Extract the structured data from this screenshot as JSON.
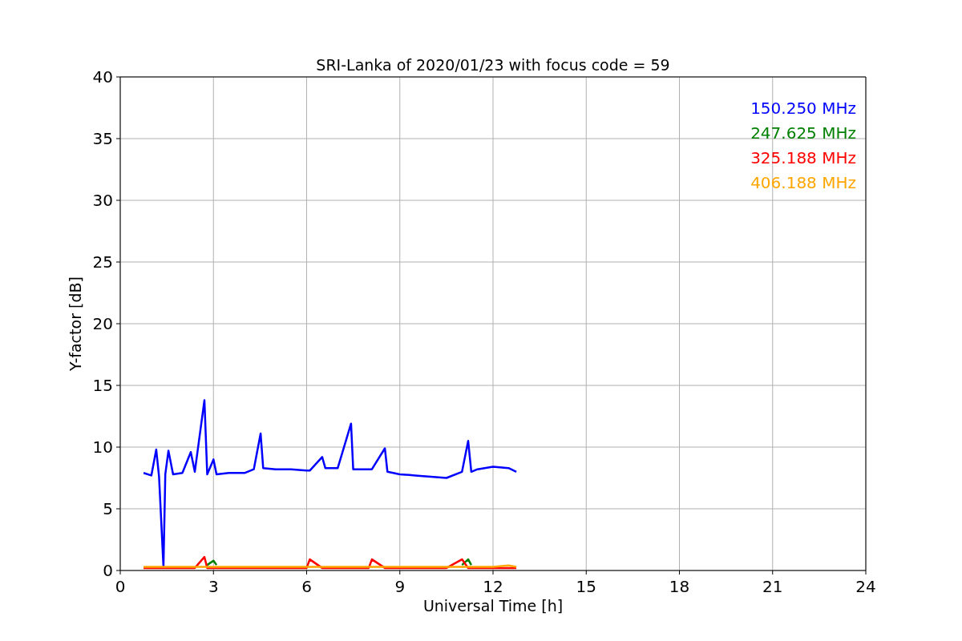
{
  "figure": {
    "chart_data": {
      "type": "line",
      "title": "SRI-Lanka of 2020/01/23 with focus code = 59",
      "xlabel": "Universal Time [h]",
      "ylabel": "Y-factor [dB]",
      "xlim": [
        0,
        24
      ],
      "ylim": [
        0,
        40
      ],
      "xticks": [
        0,
        3,
        6,
        9,
        12,
        15,
        18,
        21,
        24
      ],
      "yticks": [
        0,
        5,
        10,
        15,
        20,
        25,
        30,
        35,
        40
      ],
      "grid": true,
      "x": [
        0.75,
        1.0,
        1.16,
        1.25,
        1.39,
        1.45,
        1.55,
        1.7,
        2.0,
        2.27,
        2.4,
        2.71,
        2.8,
        3.0,
        3.1,
        3.5,
        4.0,
        4.3,
        4.52,
        4.6,
        5.0,
        5.5,
        6.0,
        6.1,
        6.5,
        6.6,
        7.0,
        7.43,
        7.5,
        8.0,
        8.1,
        8.52,
        8.6,
        9.0,
        9.5,
        10.0,
        10.5,
        11.0,
        11.2,
        11.3,
        11.5,
        12.0,
        12.5,
        12.75
      ],
      "series": [
        {
          "name": "150.250 MHz",
          "color": "#0000ff",
          "values": [
            7.9,
            7.7,
            9.8,
            7.6,
            0.3,
            7.8,
            9.7,
            7.8,
            7.9,
            9.6,
            8.0,
            13.8,
            7.8,
            9.0,
            7.8,
            7.9,
            7.9,
            8.2,
            11.1,
            8.3,
            8.2,
            8.2,
            8.1,
            8.1,
            9.2,
            8.3,
            8.3,
            11.9,
            8.2,
            8.2,
            8.2,
            9.9,
            8.0,
            7.8,
            7.7,
            7.6,
            7.5,
            8.0,
            10.5,
            8.0,
            8.2,
            8.4,
            8.3,
            8.0
          ]
        },
        {
          "name": "247.625 MHz",
          "color": "#008000",
          "values": [
            null,
            null,
            null,
            null,
            null,
            null,
            null,
            null,
            null,
            null,
            null,
            null,
            0.45,
            0.8,
            0.45,
            null,
            null,
            null,
            null,
            null,
            null,
            null,
            null,
            null,
            null,
            null,
            null,
            null,
            null,
            null,
            null,
            null,
            null,
            null,
            null,
            null,
            null,
            0.45,
            0.9,
            0.45,
            null,
            null,
            null,
            null
          ]
        },
        {
          "name": "325.188 MHz",
          "color": "#ff0000",
          "values": [
            0.2,
            0.2,
            0.2,
            0.2,
            0.2,
            0.2,
            0.2,
            0.2,
            0.2,
            0.2,
            0.2,
            1.1,
            0.2,
            0.2,
            0.2,
            0.2,
            0.2,
            0.2,
            0.2,
            0.2,
            0.2,
            0.2,
            0.2,
            0.9,
            0.2,
            0.2,
            0.2,
            0.2,
            0.2,
            0.2,
            0.9,
            0.2,
            0.2,
            0.2,
            0.2,
            0.2,
            0.2,
            0.9,
            0.2,
            0.2,
            0.2,
            0.2,
            0.2,
            0.2
          ]
        },
        {
          "name": "406.188 MHz",
          "color": "#ffa500",
          "values": [
            0.3,
            0.3,
            0.3,
            0.3,
            0.3,
            0.3,
            0.3,
            0.3,
            0.3,
            0.3,
            0.3,
            0.3,
            0.3,
            0.3,
            0.3,
            0.3,
            0.3,
            0.3,
            0.3,
            0.3,
            0.3,
            0.3,
            0.3,
            0.3,
            0.3,
            0.3,
            0.3,
            0.3,
            0.3,
            0.3,
            0.3,
            0.3,
            0.3,
            0.3,
            0.3,
            0.3,
            0.3,
            0.3,
            0.3,
            0.3,
            0.3,
            0.3,
            0.4,
            0.3
          ]
        }
      ]
    }
  }
}
